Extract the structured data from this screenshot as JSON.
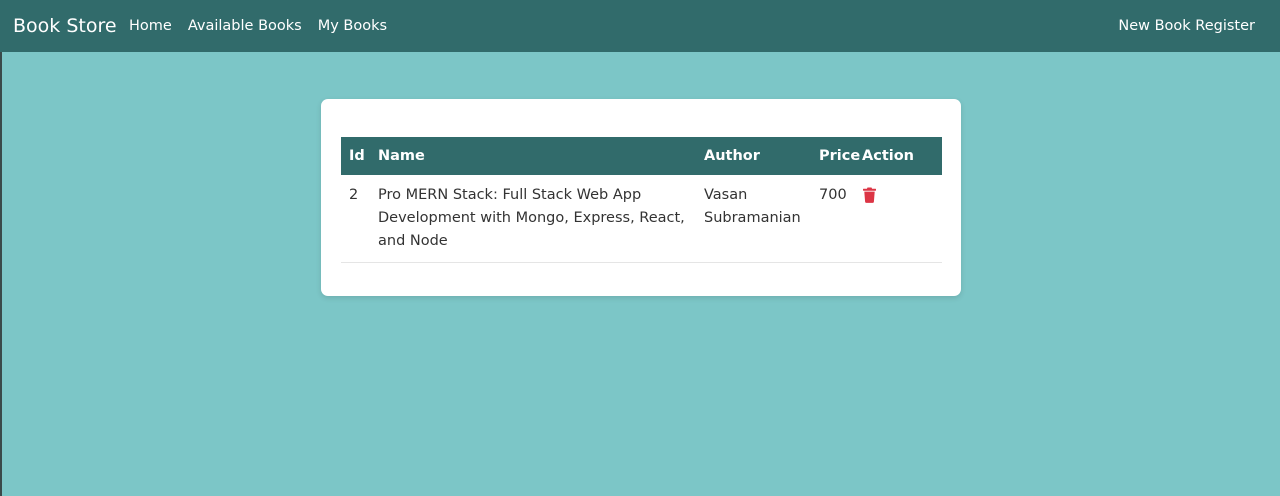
{
  "navbar": {
    "brand": "Book Store",
    "links": [
      "Home",
      "Available Books",
      "My Books"
    ],
    "right_link": "New Book Register"
  },
  "table": {
    "headers": [
      "Id",
      "Name",
      "Author",
      "Price",
      "Action"
    ],
    "rows": [
      {
        "id": "2",
        "name": "Pro MERN Stack: Full Stack Web App Development with Mongo, Express, React, and Node",
        "author": "Vasan Subramanian",
        "price": "700",
        "action_icon": "trash-icon"
      }
    ]
  },
  "colors": {
    "navbar": "#316b6b",
    "page_background": "#7cc6c7",
    "table_header": "#316b6b",
    "delete_icon": "#dc3545"
  }
}
